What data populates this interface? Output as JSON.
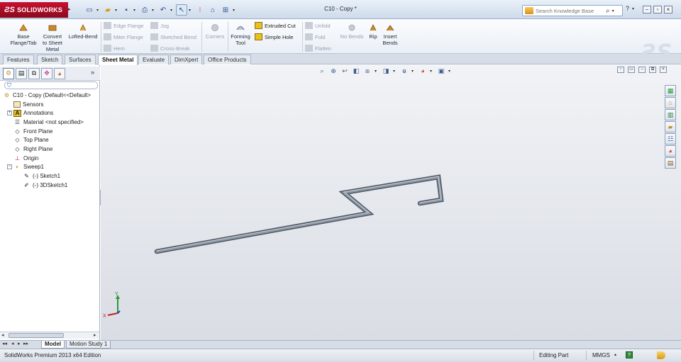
{
  "app": {
    "logo": "SOLIDWORKS",
    "document_title": "C10 - Copy *"
  },
  "search": {
    "placeholder": "Search Knowledge Base",
    "help_icon": "?"
  },
  "ribbon": {
    "base_flange": "Base Flange/Tab",
    "convert": "Convert to Sheet Metal",
    "lofted_bend": "Lofted-Bend",
    "edge_flange": "Edge Flange",
    "miter_flange": "Miter Flange",
    "hem": "Hem",
    "jog": "Jog",
    "sketched_bend": "Sketched Bend",
    "cross_break": "Cross-Break",
    "corners": "Corners",
    "forming_tool": "Forming Tool",
    "extruded_cut": "Extruded Cut",
    "simple_hole": "Simple Hole",
    "unfold": "Unfold",
    "fold": "Fold",
    "flatten": "Flatten",
    "no_bends": "No Bends",
    "rip": "Rip",
    "insert_bends": "Insert Bends"
  },
  "tabs": [
    "Features",
    "Sketch",
    "Surfaces",
    "Sheet Metal",
    "Evaluate",
    "DimXpert",
    "Office Products"
  ],
  "active_tab": "Sheet Metal",
  "tree": {
    "root": "C10 - Copy  (Default<<Default>",
    "items": [
      "Sensors",
      "Annotations",
      "Material <not specified>",
      "Front Plane",
      "Top Plane",
      "Right Plane",
      "Origin",
      "Sweep1"
    ],
    "children": [
      "(-) Sketch1",
      "(-) 3DSketch1"
    ]
  },
  "triad": {
    "x": "X",
    "y": "Y"
  },
  "bottom_tabs": [
    "Model",
    "Motion Study 1"
  ],
  "status": {
    "edition": "SolidWorks Premium 2013 x64 Edition",
    "mode": "Editing Part",
    "units": "MMGS"
  },
  "colors": {
    "accent_red": "#c8102e",
    "viewport_top": "#f1f3f6",
    "viewport_bottom": "#d9dde4",
    "model_tube": "#6b7480"
  }
}
